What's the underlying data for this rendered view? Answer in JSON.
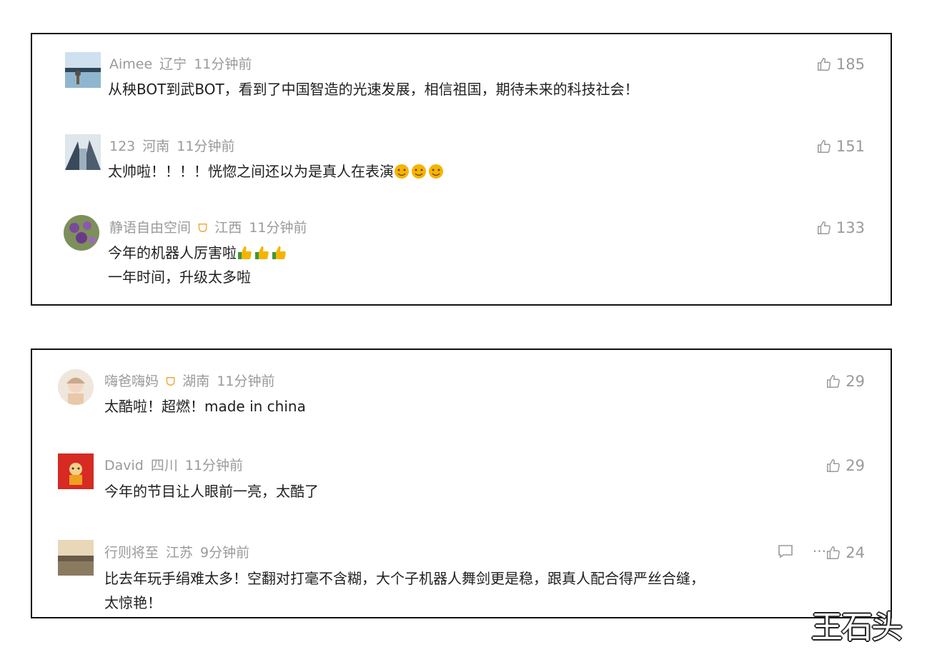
{
  "panel1": {
    "comments": [
      {
        "user": "Aimee",
        "region": "辽宁",
        "time": "11分钟前",
        "likes": "185",
        "lines": [
          "从秧BOT到武BOT，看到了中国智造的光速发展，相信祖国，期待未来的科技社会！"
        ]
      },
      {
        "user": "123",
        "region": "河南",
        "time": "11分钟前",
        "likes": "151",
        "lines": [
          "太帅啦！！！！恍惚之间还以为是真人在表演"
        ]
      },
      {
        "user": "静语自由空间",
        "region": "江西",
        "time": "11分钟前",
        "likes": "133",
        "lines": [
          "今年的机器人厉害啦",
          "一年时间，升级太多啦"
        ]
      }
    ]
  },
  "panel2": {
    "comments": [
      {
        "user": "嗨爸嗨妈",
        "region": "湖南",
        "time": "11分钟前",
        "likes": "29",
        "lines": [
          "太酷啦！超燃！made in china"
        ]
      },
      {
        "user": "David",
        "region": "四川",
        "time": "11分钟前",
        "likes": "29",
        "lines": [
          "今年的节目让人眼前一亮，太酷了"
        ]
      },
      {
        "user": "行则将至",
        "region": "江苏",
        "time": "9分钟前",
        "likes": "24",
        "more": "···",
        "lines": [
          "比去年玩手绢难太多！空翻对打毫不含糊，大个子机器人舞剑更是稳，跟真人配合得严丝合缝，",
          "太惊艳！"
        ]
      }
    ]
  },
  "vip_badge": "ᗜ",
  "watermark": "王石头",
  "colors": {
    "meta": "#9a9a9a",
    "vip": "#f0a830",
    "text": "#1f1f1f"
  }
}
